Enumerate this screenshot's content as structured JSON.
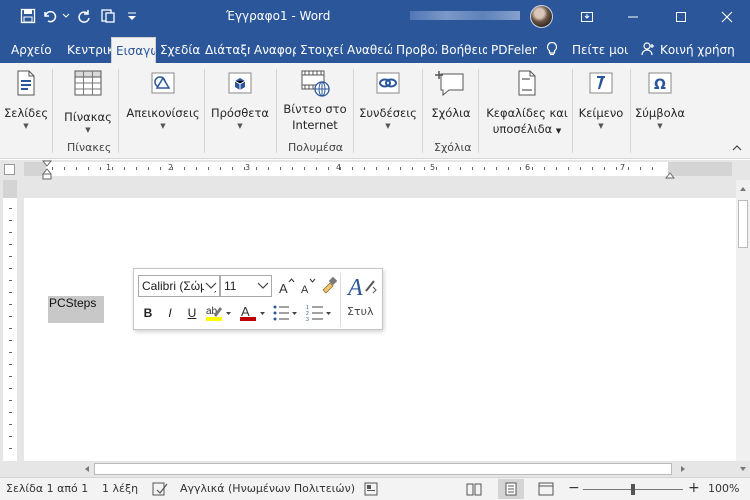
{
  "window": {
    "title": "Έγγραφο1 - Word"
  },
  "tabs": [
    {
      "label": "Αρχείο"
    },
    {
      "label": "Κεντρική"
    },
    {
      "label": "Εισαγωγή"
    },
    {
      "label": "Σχεδίαση"
    },
    {
      "label": "Διάταξη"
    },
    {
      "label": "Αναφορές"
    },
    {
      "label": "Στοιχεία"
    },
    {
      "label": "Αναθεώρηση"
    },
    {
      "label": "Προβολή"
    },
    {
      "label": "Βοήθεια"
    },
    {
      "label": "PDFelement"
    }
  ],
  "tell_me": "Πείτε μου",
  "share": "Κοινή χρήση",
  "ribbon": {
    "pages": "Σελίδες",
    "table": "Πίνακας",
    "tables_group": "Πίνακες",
    "illustrations": "Απεικονίσεις",
    "addins": "Πρόσθετα",
    "video_line1": "Βίντεο στο",
    "video_line2": "Internet",
    "media_group": "Πολυμέσα",
    "links": "Συνδέσεις",
    "comments": "Σχόλια",
    "comments_group": "Σχόλια",
    "header_line1": "Κεφαλίδες και",
    "header_line2": "υποσέλιδα",
    "text": "Κείμενο",
    "symbols": "Σύμβολα"
  },
  "document": {
    "selected_text": "PCSteps"
  },
  "mini_toolbar": {
    "font": "Calibri (Σώμα)",
    "size": "11",
    "bold": "B",
    "italic": "I",
    "underline": "U",
    "styles": "Στυλ"
  },
  "status": {
    "page": "Σελίδα 1 από 1",
    "words": "1 λέξη",
    "language": "Αγγλικά (Ηνωμένων Πολιτειών)",
    "zoom": "100%"
  },
  "colors": {
    "accent": "#2b579a",
    "highlight": "#ffff00",
    "font_color": "#c00000"
  },
  "ruler_numbers": [
    "1",
    "2",
    "3",
    "4",
    "5",
    "6",
    "7"
  ]
}
